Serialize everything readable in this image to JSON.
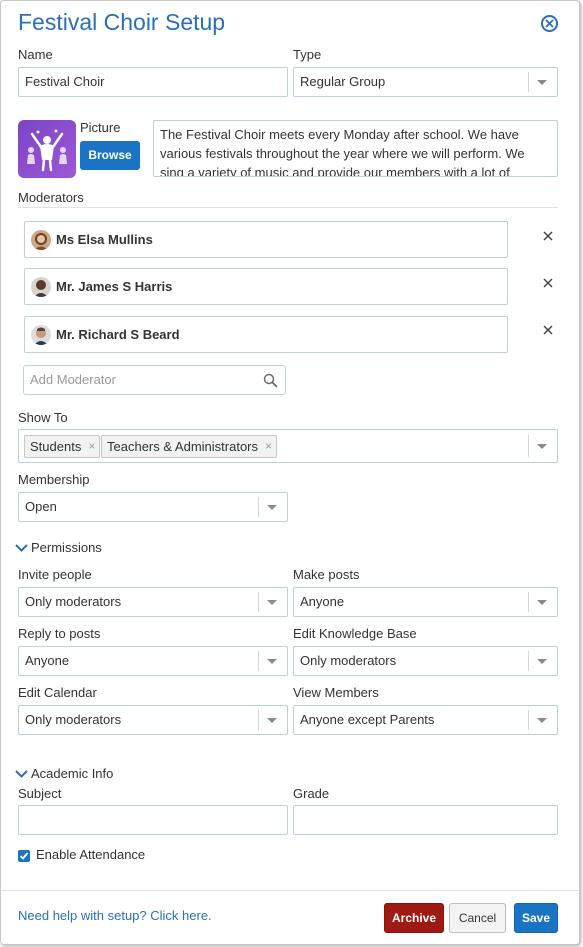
{
  "modal": {
    "title": "Festival Choir Setup"
  },
  "name": {
    "label": "Name",
    "value": "Festival Choir"
  },
  "type": {
    "label": "Type",
    "value": "Regular Group"
  },
  "picture": {
    "label": "Picture",
    "browse_label": "Browse"
  },
  "description": "The Festival Choir meets every Monday after school. We have various festivals throughout the year where we will perform. We sing a variety of music and provide our members with a lot of",
  "moderators": {
    "label": "Moderators",
    "items": [
      {
        "name": "Ms Elsa Mullins"
      },
      {
        "name": "Mr. James S Harris"
      },
      {
        "name": "Mr. Richard S Beard"
      }
    ],
    "add_placeholder": "Add Moderator"
  },
  "show_to": {
    "label": "Show To",
    "tags": [
      "Students",
      "Teachers & Administrators"
    ]
  },
  "membership": {
    "label": "Membership",
    "value": "Open"
  },
  "permissions": {
    "label": "Permissions",
    "invite_people": {
      "label": "Invite people",
      "value": "Only moderators"
    },
    "make_posts": {
      "label": "Make posts",
      "value": "Anyone"
    },
    "reply_to_posts": {
      "label": "Reply to posts",
      "value": "Anyone"
    },
    "edit_knowledge_base": {
      "label": "Edit Knowledge Base",
      "value": "Only moderators"
    },
    "edit_calendar": {
      "label": "Edit Calendar",
      "value": "Only moderators"
    },
    "view_members": {
      "label": "View Members",
      "value": "Anyone except Parents"
    }
  },
  "academic_info": {
    "label": "Academic Info",
    "subject": {
      "label": "Subject",
      "value": ""
    },
    "grade": {
      "label": "Grade",
      "value": ""
    },
    "enable_attendance": {
      "label": "Enable Attendance",
      "checked": true
    }
  },
  "footer": {
    "help_link": "Need help with setup? Click here.",
    "archive_label": "Archive",
    "cancel_label": "Cancel",
    "save_label": "Save"
  },
  "colors": {
    "accent": "#2a6fb8",
    "primary_button": "#1b74c3",
    "danger_button": "#9e1a12",
    "group_picture": "#8a4fd0"
  },
  "icons": {
    "close": "close-circle-icon",
    "search": "search-icon",
    "remove": "x-icon",
    "chevron": "chevron-down-icon",
    "checkbox": "check-icon"
  }
}
